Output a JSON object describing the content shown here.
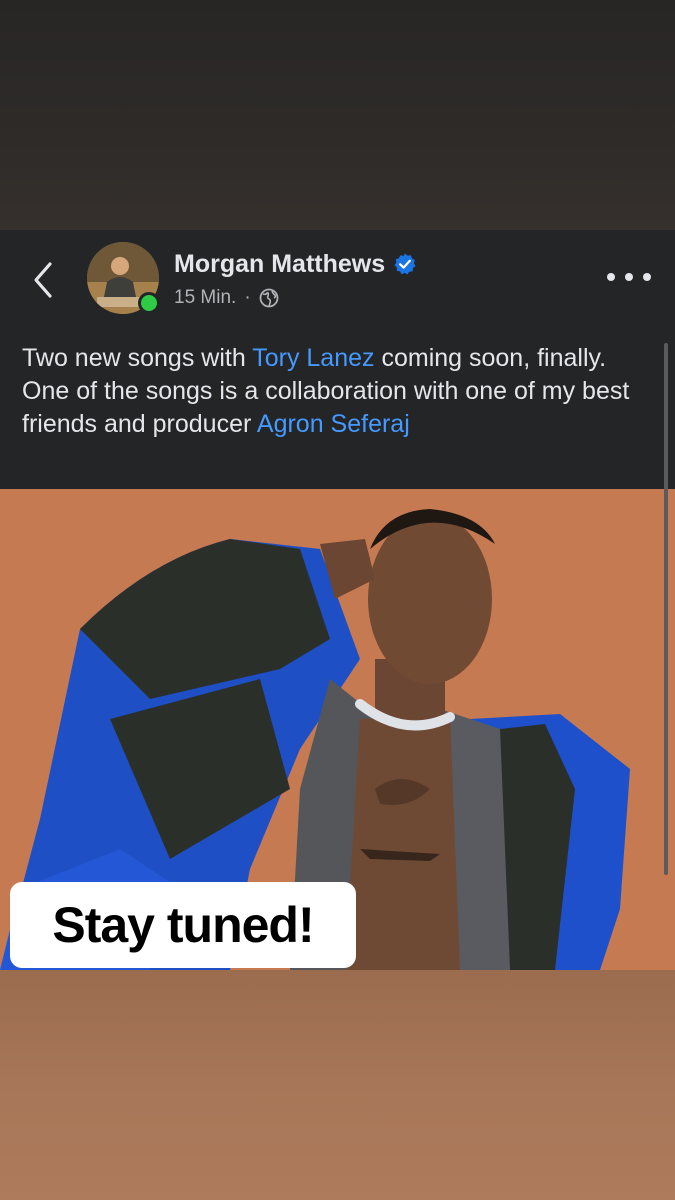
{
  "post": {
    "author_name": "Morgan Matthews",
    "verified_icon": "verified-badge-icon",
    "timestamp": "15 Min.",
    "separator": "·",
    "audience_icon": "globe-icon",
    "caption": {
      "line1_prefix": "Two new songs with ",
      "link1": "Tory Lanez",
      "line1_suffix": " coming soon, finally.",
      "line2_prefix": "One of the songs is a collaboration with one of my best friends and producer ",
      "link2": "Agron Seferaj"
    },
    "overlay_text": "Stay tuned!"
  },
  "colors": {
    "background": "#242526",
    "text": "#e4e6eb",
    "link": "#4599ff",
    "online": "#31cc46",
    "verified": "#1b74e4",
    "photo_backdrop": "#c87b53"
  }
}
